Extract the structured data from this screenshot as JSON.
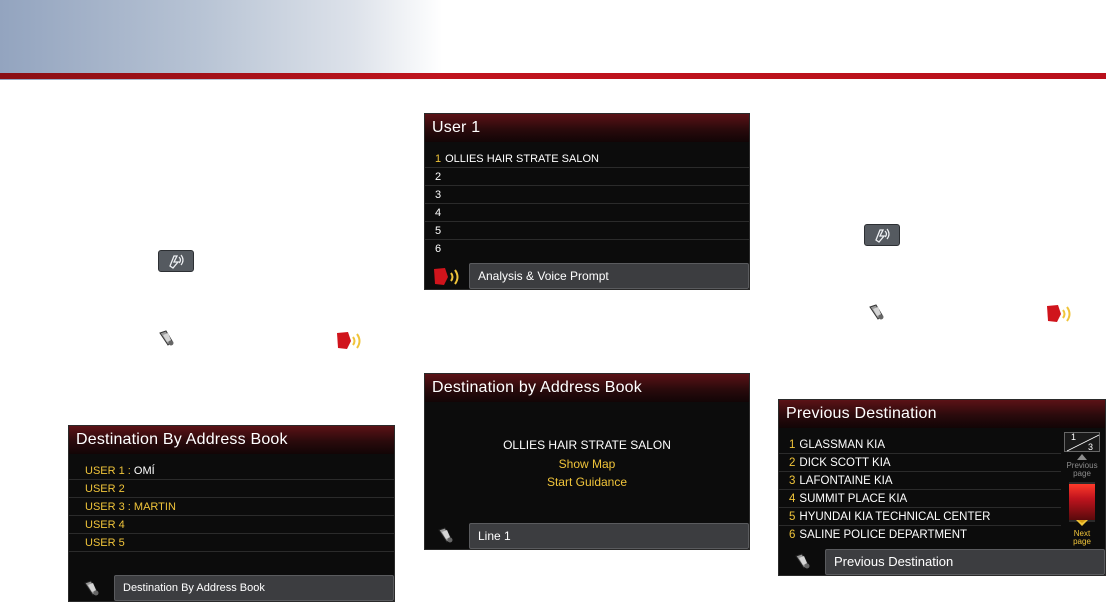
{
  "colors": {
    "brand_red": "#c0141e",
    "highlight_yellow": "#f0c43a",
    "panel_bg": "#0c0c0c"
  },
  "icons": {
    "talk": "talk-icon",
    "speaker": "speaker-icon",
    "voice_prompt": "voice-prompt-icon"
  },
  "panel_user1": {
    "title": "User 1",
    "rows": [
      {
        "num": "1",
        "text": "OLLIES HAIR STRATE SALON"
      },
      {
        "num": "2",
        "text": ""
      },
      {
        "num": "3",
        "text": ""
      },
      {
        "num": "4",
        "text": ""
      },
      {
        "num": "5",
        "text": ""
      },
      {
        "num": "6",
        "text": ""
      }
    ],
    "footer_label": "Analysis & Voice Prompt"
  },
  "panel_dest_addr_book": {
    "title": "Destination by Address Book",
    "name": "OLLIES HAIR STRATE SALON",
    "option_show_map": "Show Map",
    "option_start_guidance": "Start Guidance",
    "footer_label": "Line 1"
  },
  "panel_dest_by_book_users": {
    "title": "Destination By Address Book",
    "rows": [
      {
        "label": "USER 1",
        "sep": " : ",
        "value": "OMÍ"
      },
      {
        "label": "USER 2",
        "sep": "",
        "value": ""
      },
      {
        "label": "USER 3",
        "sep": " : ",
        "value": "MARTIN"
      },
      {
        "label": "USER 4",
        "sep": "",
        "value": ""
      },
      {
        "label": "USER 5",
        "sep": "",
        "value": ""
      }
    ],
    "footer_label": "Destination By Address Book"
  },
  "panel_previous_dest": {
    "title": "Previous Destination",
    "rows": [
      {
        "num": "1",
        "text": "GLASSMAN KIA"
      },
      {
        "num": "2",
        "text": "DICK SCOTT KIA"
      },
      {
        "num": "3",
        "text": "LAFONTAINE KIA"
      },
      {
        "num": "4",
        "text": "SUMMIT PLACE KIA"
      },
      {
        "num": "5",
        "text": "HYUNDAI KIA TECHNICAL CENTER"
      },
      {
        "num": "6",
        "text": "SALINE POLICE DEPARTMENT"
      }
    ],
    "page_current": "1",
    "page_total": "3",
    "prev_label": "Previous page",
    "next_label": "Next page",
    "footer_label": "Previous Destination"
  }
}
